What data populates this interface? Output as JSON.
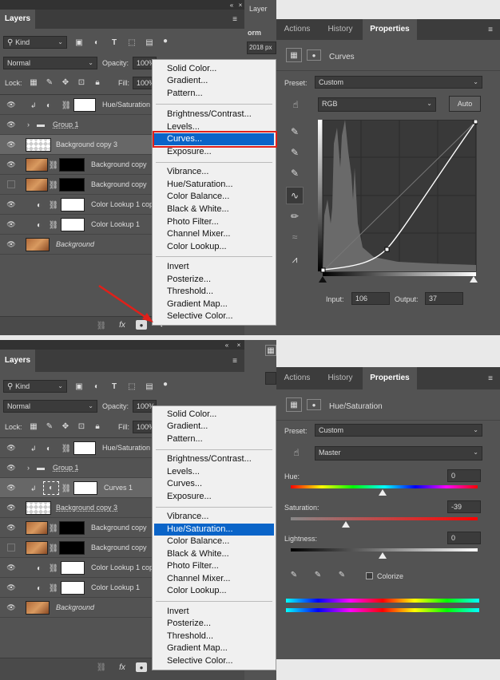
{
  "top": {
    "layers_panel": {
      "tab": "Layers",
      "filter_kind": "Kind",
      "blend_mode": "Normal",
      "opacity_label": "Opacity:",
      "opacity_value": "100%",
      "lock_label": "Lock:",
      "fill_label": "Fill:",
      "fill_value": "100%",
      "layers": [
        {
          "name": "Hue/Saturation"
        },
        {
          "name": "Group 1"
        },
        {
          "name": "Background copy 3"
        },
        {
          "name": "Background copy"
        },
        {
          "name": "Background copy"
        },
        {
          "name": "Color Lookup 1 cop"
        },
        {
          "name": "Color Lookup 1"
        },
        {
          "name": "Background"
        }
      ]
    },
    "peek": {
      "layer_label": "Layer",
      "form_label": "orm",
      "px_value": "2018 px"
    },
    "menu": {
      "group1": [
        "Solid Color...",
        "Gradient...",
        "Pattern..."
      ],
      "group2": [
        "Brightness/Contrast...",
        "Levels...",
        "Curves...",
        "Exposure..."
      ],
      "group3": [
        "Vibrance...",
        "Hue/Saturation...",
        "Color Balance...",
        "Black & White...",
        "Photo Filter...",
        "Channel Mixer...",
        "Color Lookup..."
      ],
      "group4": [
        "Invert",
        "Posterize...",
        "Threshold...",
        "Gradient Map...",
        "Selective Color..."
      ]
    },
    "properties": {
      "tabs": [
        "Actions",
        "History",
        "Properties"
      ],
      "title": "Curves",
      "preset_label": "Preset:",
      "preset_value": "Custom",
      "channel": "RGB",
      "auto_label": "Auto",
      "input_label": "Input:",
      "input_value": "106",
      "output_label": "Output:",
      "output_value": "37"
    }
  },
  "bottom": {
    "layers_panel": {
      "tab": "Layers",
      "filter_kind": "Kind",
      "blend_mode": "Normal",
      "opacity_label": "Opacity:",
      "opacity_value": "100%",
      "lock_label": "Lock:",
      "fill_label": "Fill:",
      "fill_value": "100%",
      "layers": [
        {
          "name": "Hue/Saturation"
        },
        {
          "name": "Group 1"
        },
        {
          "name": "Curves 1"
        },
        {
          "name": "Background copy 3"
        },
        {
          "name": "Background copy"
        },
        {
          "name": "Background copy"
        },
        {
          "name": "Color Lookup 1 cop"
        },
        {
          "name": "Color Lookup 1"
        },
        {
          "name": "Background"
        }
      ]
    },
    "menu": {
      "group1": [
        "Solid Color...",
        "Gradient...",
        "Pattern..."
      ],
      "group2": [
        "Brightness/Contrast...",
        "Levels...",
        "Curves...",
        "Exposure..."
      ],
      "group3": [
        "Vibrance...",
        "Hue/Saturation...",
        "Color Balance...",
        "Black & White...",
        "Photo Filter...",
        "Channel Mixer...",
        "Color Lookup..."
      ],
      "group4": [
        "Invert",
        "Posterize...",
        "Threshold...",
        "Gradient Map...",
        "Selective Color..."
      ]
    },
    "properties": {
      "tabs": [
        "Actions",
        "History",
        "Properties"
      ],
      "title": "Hue/Saturation",
      "preset_label": "Preset:",
      "preset_value": "Custom",
      "channel": "Master",
      "hue_label": "Hue:",
      "hue_value": "0",
      "saturation_label": "Saturation:",
      "saturation_value": "-39",
      "lightness_label": "Lightness:",
      "lightness_value": "0",
      "colorize_label": "Colorize"
    }
  },
  "colors": {
    "menu_highlight": "#0a64c8",
    "callout_red": "#e0201a",
    "panel_bg": "#535353"
  }
}
